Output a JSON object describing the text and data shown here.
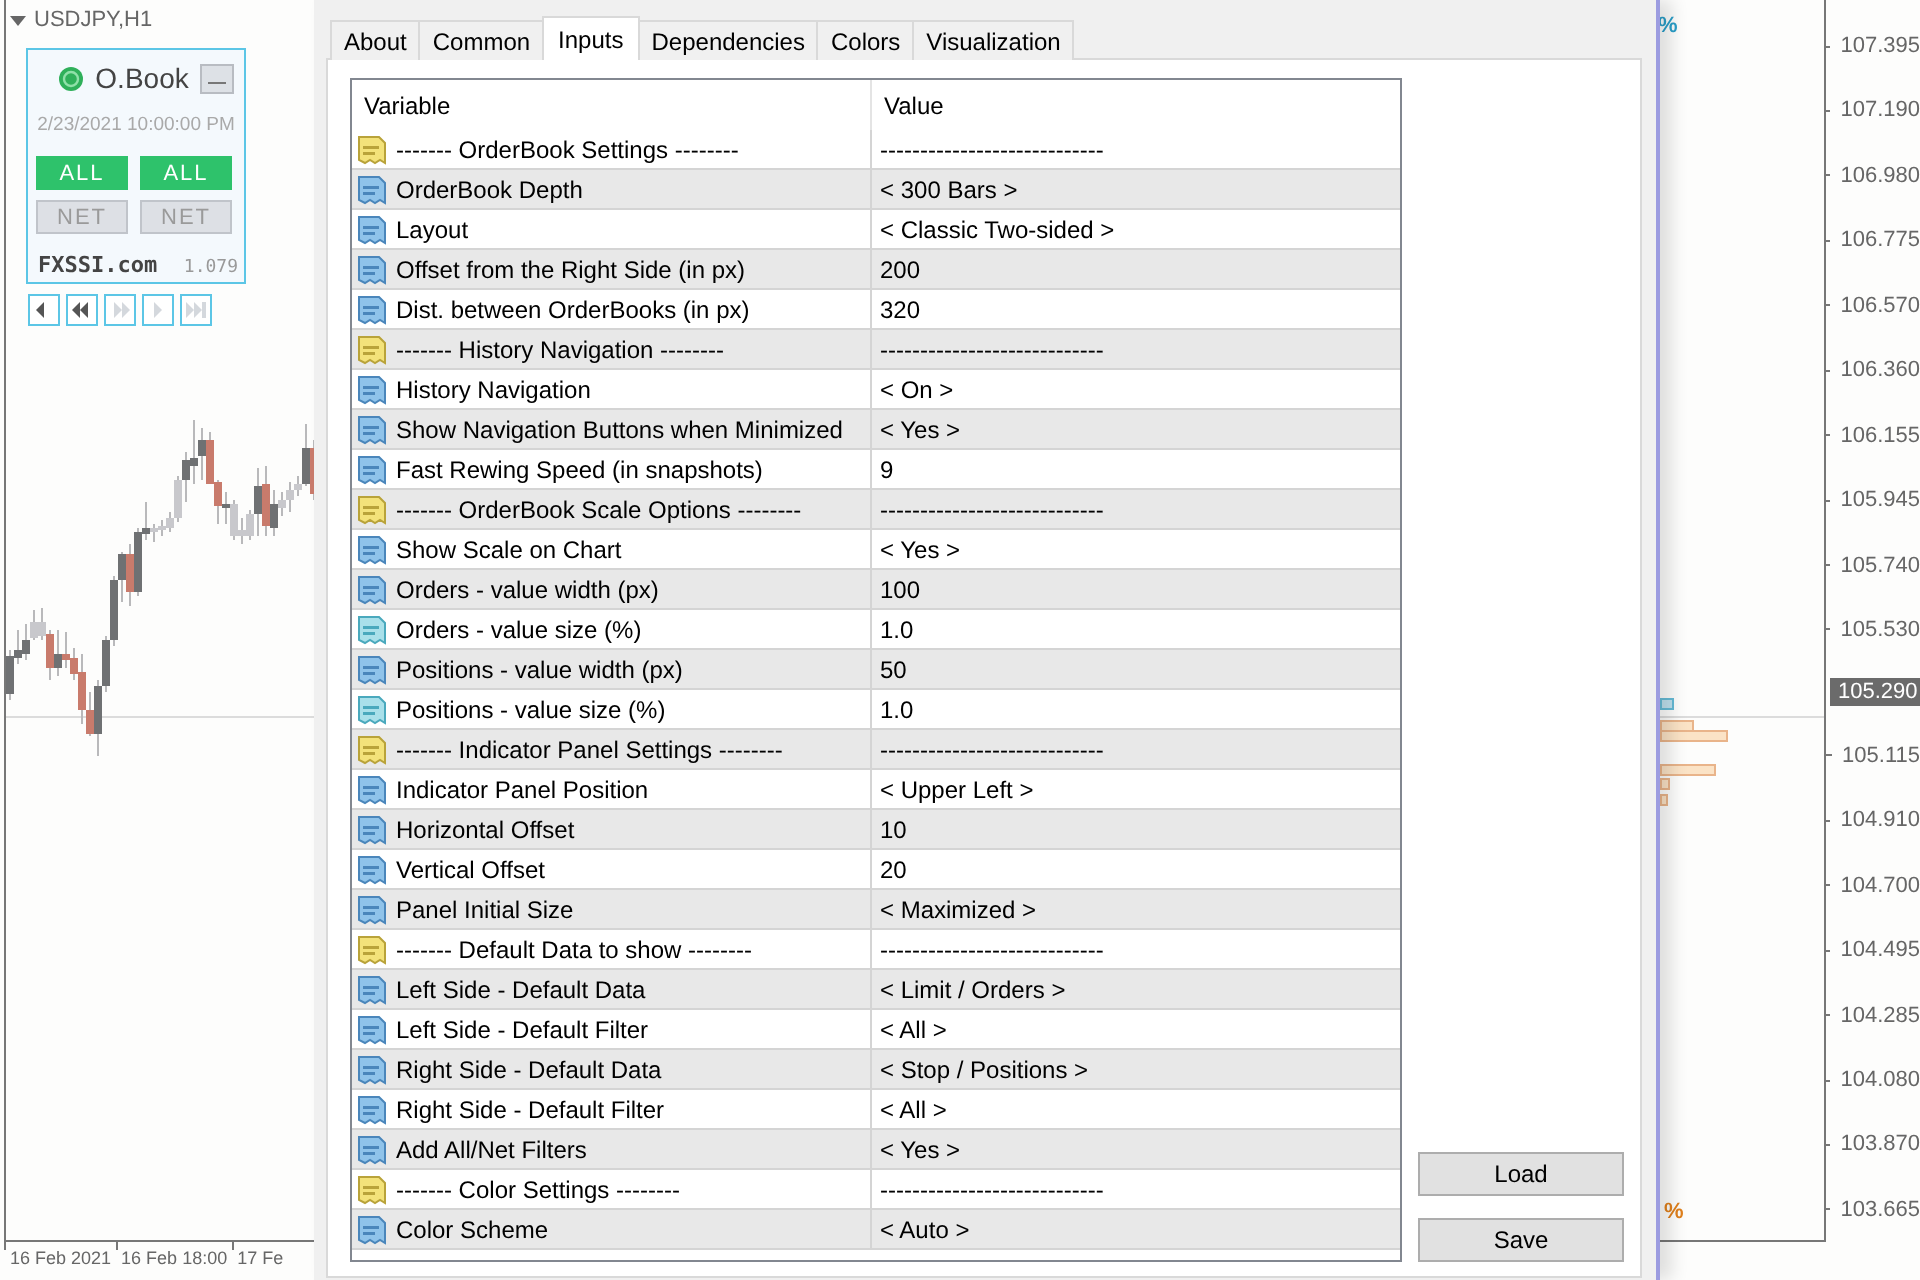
{
  "chart": {
    "symbol": "USDJPY,H1",
    "panel": {
      "title": "O.Book",
      "datetime": "2/23/2021 10:00:00 PM",
      "filters": [
        {
          "label": "ALL",
          "selected": true
        },
        {
          "label": "ALL",
          "selected": true
        },
        {
          "label": "NET",
          "selected": false
        },
        {
          "label": "NET",
          "selected": false
        }
      ],
      "site": "FXSSI.com",
      "version": "1.079"
    },
    "nav_buttons": [
      {
        "kind": "step-back",
        "disabled": false
      },
      {
        "kind": "rewind",
        "disabled": false
      },
      {
        "kind": "fast-forward",
        "disabled": true
      },
      {
        "kind": "step-forward",
        "disabled": true
      },
      {
        "kind": "end",
        "disabled": true
      }
    ],
    "percent_marks": [
      {
        "text": "%",
        "color": "#2a9fc9"
      },
      {
        "text": "%",
        "color": "#e0801c"
      }
    ],
    "price_axis": [
      {
        "kind": "tick",
        "label": "107.395"
      },
      {
        "kind": "tick",
        "label": "107.190"
      },
      {
        "kind": "tick",
        "label": "106.980"
      },
      {
        "kind": "tick",
        "label": "106.775"
      },
      {
        "kind": "tick",
        "label": "106.570"
      },
      {
        "kind": "tick",
        "label": "106.360"
      },
      {
        "kind": "tick",
        "label": "106.155"
      },
      {
        "kind": "tick",
        "label": "105.945"
      },
      {
        "kind": "tick",
        "label": "105.740"
      },
      {
        "kind": "tick",
        "label": "105.530"
      },
      {
        "kind": "current",
        "label": "105.290"
      },
      {
        "kind": "tick",
        "label": "105.115"
      },
      {
        "kind": "tick",
        "label": "104.910"
      },
      {
        "kind": "tick",
        "label": "104.700"
      },
      {
        "kind": "tick",
        "label": "104.495"
      },
      {
        "kind": "tick",
        "label": "104.285"
      },
      {
        "kind": "tick",
        "label": "104.080"
      },
      {
        "kind": "tick",
        "label": "103.870"
      },
      {
        "kind": "tick",
        "label": "103.665"
      }
    ],
    "time_axis": [
      "16 Feb 2021",
      "16 Feb 18:00",
      "17 Fe"
    ]
  },
  "dialog": {
    "tabs": [
      {
        "label": "About",
        "selected": false
      },
      {
        "label": "Common",
        "selected": false
      },
      {
        "label": "Inputs",
        "selected": true
      },
      {
        "label": "Dependencies",
        "selected": false
      },
      {
        "label": "Colors",
        "selected": false
      },
      {
        "label": "Visualization",
        "selected": false
      }
    ],
    "table": {
      "columns": [
        "Variable",
        "Value"
      ],
      "rows": [
        {
          "kind": "string",
          "variable": "------- OrderBook Settings --------",
          "value": "----------------------------"
        },
        {
          "kind": "integer",
          "variable": "OrderBook Depth",
          "value": "< 300 Bars >"
        },
        {
          "kind": "integer",
          "variable": "Layout",
          "value": "< Classic Two-sided >"
        },
        {
          "kind": "integer",
          "variable": "Offset from the Right Side (in px)",
          "value": "200"
        },
        {
          "kind": "integer",
          "variable": "Dist. between OrderBooks (in px)",
          "value": "320"
        },
        {
          "kind": "string",
          "variable": "------- History Navigation --------",
          "value": "----------------------------"
        },
        {
          "kind": "integer",
          "variable": "History Navigation",
          "value": "< On >"
        },
        {
          "kind": "integer",
          "variable": "Show Navigation Buttons when Minimized",
          "value": "< Yes >"
        },
        {
          "kind": "integer",
          "variable": "Fast Rewing Speed (in snapshots)",
          "value": "9"
        },
        {
          "kind": "string",
          "variable": "------- OrderBook Scale Options --------",
          "value": "----------------------------"
        },
        {
          "kind": "integer",
          "variable": "Show Scale on Chart",
          "value": "< Yes >"
        },
        {
          "kind": "integer",
          "variable": "Orders - value width (px)",
          "value": "100"
        },
        {
          "kind": "double",
          "variable": "Orders - value size (%)",
          "value": "1.0"
        },
        {
          "kind": "integer",
          "variable": "Positions - value width (px)",
          "value": "50"
        },
        {
          "kind": "double",
          "variable": "Positions - value size (%)",
          "value": "1.0"
        },
        {
          "kind": "string",
          "variable": "------- Indicator Panel Settings --------",
          "value": "----------------------------"
        },
        {
          "kind": "integer",
          "variable": "Indicator Panel Position",
          "value": "< Upper Left >"
        },
        {
          "kind": "integer",
          "variable": "Horizontal Offset",
          "value": "10"
        },
        {
          "kind": "integer",
          "variable": "Vertical Offset",
          "value": "20"
        },
        {
          "kind": "integer",
          "variable": "Panel Initial Size",
          "value": "< Maximized >"
        },
        {
          "kind": "string",
          "variable": "------- Default Data to show --------",
          "value": "----------------------------"
        },
        {
          "kind": "integer",
          "variable": "Left Side - Default Data",
          "value": "< Limit / Orders >"
        },
        {
          "kind": "integer",
          "variable": "Left Side - Default Filter",
          "value": "< All >"
        },
        {
          "kind": "integer",
          "variable": "Right Side - Default Data",
          "value": "< Stop / Positions >"
        },
        {
          "kind": "integer",
          "variable": "Right Side - Default Filter",
          "value": "< All >"
        },
        {
          "kind": "integer",
          "variable": "Add All/Net Filters",
          "value": "< Yes >"
        },
        {
          "kind": "string",
          "variable": "------- Color Settings --------",
          "value": "----------------------------"
        },
        {
          "kind": "integer",
          "variable": "Color Scheme",
          "value": "< Auto >"
        }
      ]
    },
    "buttons": [
      "Load",
      "Save"
    ]
  }
}
